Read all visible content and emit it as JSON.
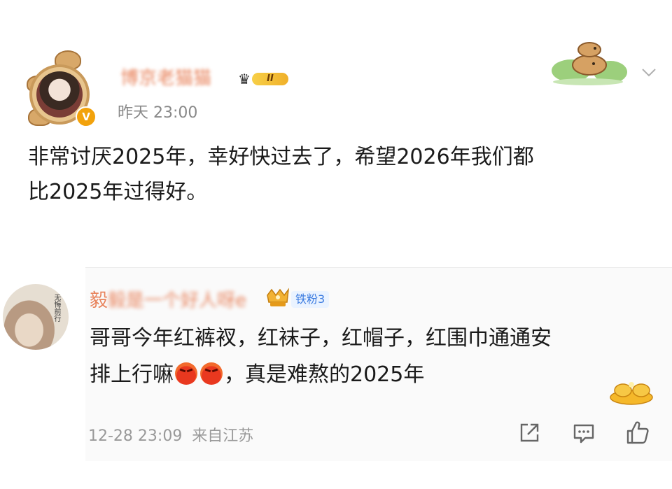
{
  "post": {
    "author": "博京老猫猫",
    "vip_level": "II",
    "verified_badge": "V",
    "time": "昨天 23:00",
    "body": "非常讨厌2025年，幸好快过去了，希望2026年我们都\n比2025年过得好。",
    "icons": [
      "crown-icon",
      "capybara-decor-icon",
      "chevron-down-icon"
    ]
  },
  "comment": {
    "author_visible": "毅",
    "author_blurred": "毅是一个好人呀e",
    "fan_badge": "铁粉3",
    "text_part1": "哥哥今年红裤衩，红袜子，红帽子，红围巾通通安",
    "text_part2": "排上行嘛",
    "text_part3": "，真是难熬的2025年",
    "emoji_name": "angry-emoji",
    "time_location": "12-28 23:09  来自江苏",
    "avatar_text": "无悔前行",
    "actions": [
      "share-icon",
      "comment-icon",
      "like-icon"
    ]
  },
  "colors": {
    "username": "#e8835c",
    "fan_badge": "#3b7be0",
    "muted": "#999999",
    "vip_gold": "#f0b02a"
  }
}
